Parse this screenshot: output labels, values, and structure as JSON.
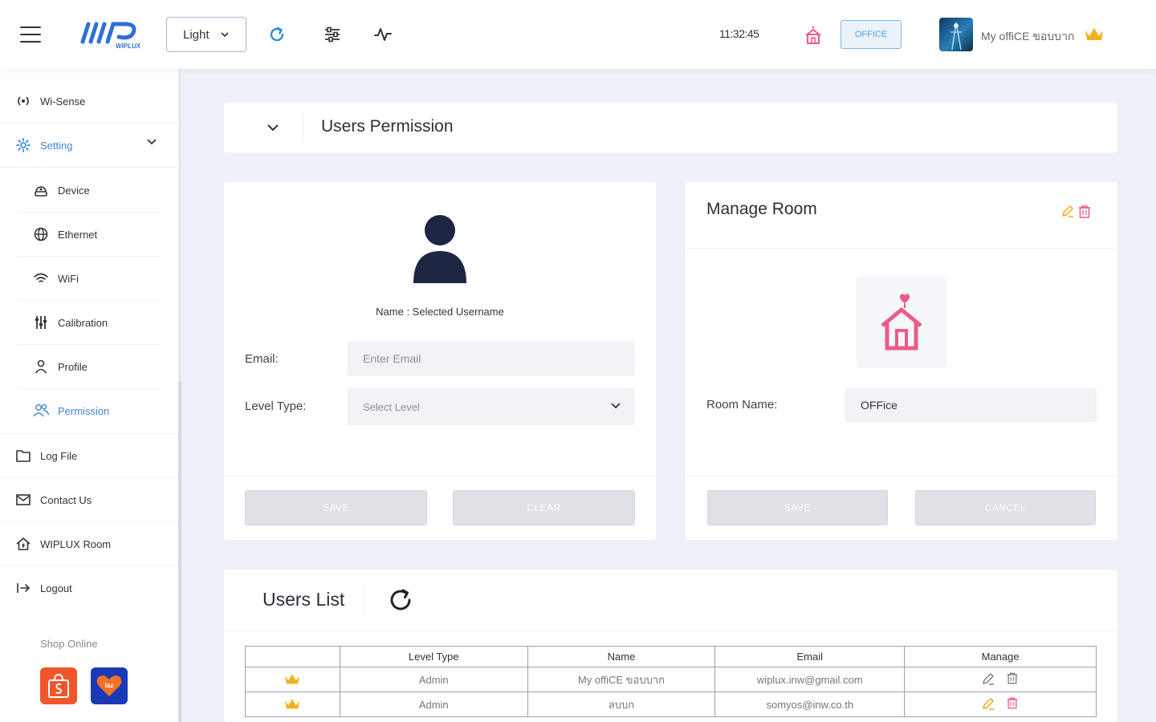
{
  "header": {
    "theme_value": "Light",
    "clock": "11:32:45",
    "room_chip": "OFFICE",
    "user_name": "My offiCE ขอบบาก",
    "colors": {
      "accent_blue": "#2f6fd6",
      "pink": "#ec5b86",
      "gold": "#f3b21b"
    }
  },
  "sidebar": {
    "items": [
      {
        "label": "Wi-Sense",
        "icon": "wi-sense-icon"
      },
      {
        "label": "Setting",
        "icon": "gear-icon",
        "expanded": true
      },
      {
        "label": "Device",
        "icon": "device-icon"
      },
      {
        "label": "Ethernet",
        "icon": "globe-icon"
      },
      {
        "label": "WiFi",
        "icon": "wifi-icon"
      },
      {
        "label": "Calibration",
        "icon": "sliders-icon"
      },
      {
        "label": "Profile",
        "icon": "person-icon"
      },
      {
        "label": "Permission",
        "icon": "users-icon",
        "active": true
      },
      {
        "label": "Log File",
        "icon": "folder-icon"
      },
      {
        "label": "Contact Us",
        "icon": "mail-icon"
      },
      {
        "label": "WIPLUX Room",
        "icon": "home-icon"
      },
      {
        "label": "Logout",
        "icon": "logout-icon"
      }
    ],
    "shop_title": "Shop Online",
    "shop_lazada_text": "laz"
  },
  "main": {
    "section_title": "Users Permission",
    "user_form": {
      "name_line": "Name : Selected Username",
      "email_label": "Email:",
      "email_placeholder": "Enter Email",
      "level_label": "Level Type:",
      "level_placeholder": "Select Level",
      "save_label": "SAVE",
      "clear_label": "CLEAR"
    },
    "manage_room": {
      "title": "Manage Room",
      "room_name_label": "Room Name:",
      "room_name_value": "OFFice",
      "save_label": "SAVE",
      "cancel_label": "CANCEL"
    },
    "users_list": {
      "title": "Users List",
      "columns": [
        "",
        "Level Type",
        "Name",
        "Email",
        "Manage"
      ],
      "rows": [
        {
          "level": "Admin",
          "name": "My offiCE ขอบบาก",
          "email": "wiplux.inw@gmail.com",
          "actions_enabled": false
        },
        {
          "level": "Admin",
          "name": "ลบบก",
          "email": "somyos@inw.co.th",
          "actions_enabled": true
        }
      ]
    }
  }
}
